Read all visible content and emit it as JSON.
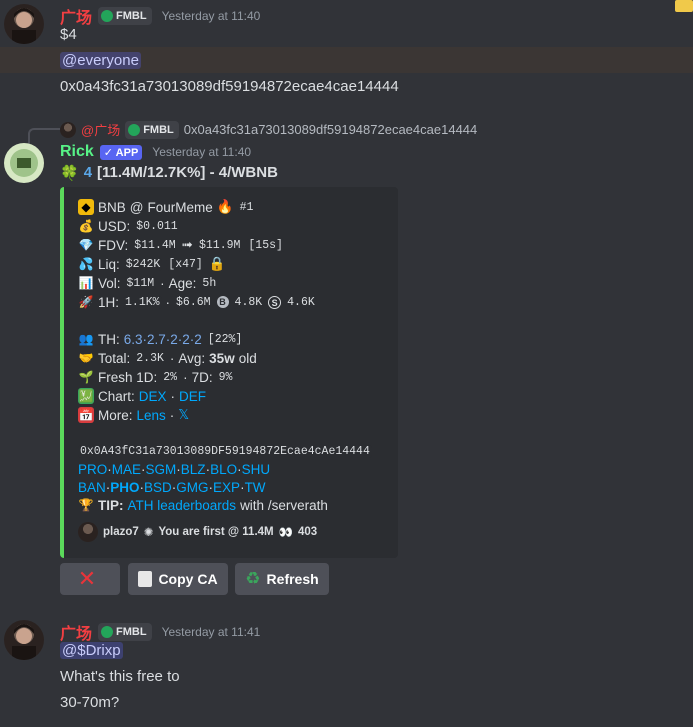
{
  "messages": [
    {
      "username": "广场",
      "tag": "FMBL",
      "timestamp": "Yesterday at 11:40",
      "lines": [
        "$4",
        "@everyone",
        "0x0a43fc31a73013089df59194872ecae4cae14444"
      ]
    },
    {
      "reply": {
        "username": "@广场",
        "tag": "FMBL",
        "text": "0x0a43fc31a73013089df59194872ecae4cae14444"
      },
      "username": "Rick",
      "badge": "APP",
      "timestamp": "Yesterday at 11:40",
      "headline": {
        "clover": "🍀",
        "num": "4",
        "rest": "[11.4M/12.7K%] - 4/WBNB"
      },
      "embed": {
        "accent": "#5bd95b",
        "token_line": {
          "chain": "BNB",
          "at": "@",
          "platform": "FourMeme",
          "rank": "#1"
        },
        "usd": {
          "label": "USD:",
          "value": "$0.011"
        },
        "fdv": {
          "label": "FDV:",
          "from": "$11.4M",
          "arrow": "➟",
          "to": "$11.9M",
          "time": "[15s]"
        },
        "liq": {
          "label": "Liq:",
          "value": "$242K",
          "mult": "[x47]"
        },
        "vol": {
          "label": "Vol:",
          "value": "$11M",
          "sep": "·",
          "age_label": "Age:",
          "age": "5h"
        },
        "h1": {
          "label": "1H:",
          "pct": "1.1K%",
          "sep": "·",
          "vol": "$6.6M",
          "buys": "4.8K",
          "sells": "4.6K"
        },
        "th": {
          "label": "TH:",
          "values": "6.3·2.7·2·2·2",
          "pct": "[22%]"
        },
        "total": {
          "label": "Total:",
          "value": "2.3K",
          "sep": "·",
          "avg_label": "Avg:",
          "avg": "35w",
          "old": "old"
        },
        "fresh": {
          "label": "Fresh 1D:",
          "d1": "2%",
          "sep": "·",
          "d7_label": "7D:",
          "d7": "9%"
        },
        "chart": {
          "label": "Chart:",
          "dex": "DEX",
          "sep": "·",
          "def": "DEF"
        },
        "more": {
          "label": "More:",
          "lens": "Lens",
          "sep": "·",
          "x": "𝕏"
        },
        "contract": "0x0A43fC31a73013089DF59194872Ecae4cAe14444",
        "links_row1": [
          "PRO",
          "MAE",
          "SGM",
          "BLZ",
          "BLO",
          "SHU"
        ],
        "links_row2": [
          "BAN",
          "PHO",
          "BSD",
          "GMG",
          "EXP",
          "TW"
        ],
        "tip": {
          "label": "TIP:",
          "link": "ATH leaderboards",
          "rest": "with /serverath"
        },
        "footer": {
          "user": "plazo7",
          "text": "You are first @ 11.4M",
          "views": "403"
        }
      },
      "buttons": [
        {
          "label": ""
        },
        {
          "label": "Copy CA"
        },
        {
          "label": "Refresh"
        }
      ]
    },
    {
      "username": "广场",
      "tag": "FMBL",
      "timestamp": "Yesterday at 11:41",
      "lines": [
        "@$Drixp",
        "What's this free to",
        "30-70m?"
      ]
    }
  ],
  "colors": {
    "background": "#313338",
    "red_name": "#f23f42",
    "green_name": "#57f287",
    "link": "#00a8fc",
    "embed_bg": "#2b2d31"
  }
}
